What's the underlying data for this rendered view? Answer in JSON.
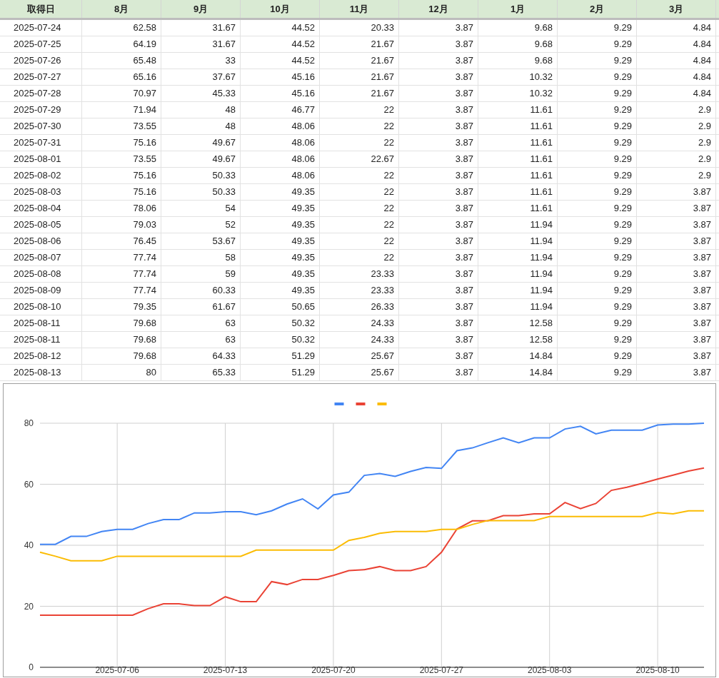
{
  "table": {
    "columns": [
      "取得日",
      "8月",
      "9月",
      "10月",
      "11月",
      "12月",
      "1月",
      "2月",
      "3月"
    ],
    "rows": [
      [
        "2025-07-24",
        "62.58",
        "31.67",
        "44.52",
        "20.33",
        "3.87",
        "9.68",
        "9.29",
        "4.84"
      ],
      [
        "2025-07-25",
        "64.19",
        "31.67",
        "44.52",
        "21.67",
        "3.87",
        "9.68",
        "9.29",
        "4.84"
      ],
      [
        "2025-07-26",
        "65.48",
        "33",
        "44.52",
        "21.67",
        "3.87",
        "9.68",
        "9.29",
        "4.84"
      ],
      [
        "2025-07-27",
        "65.16",
        "37.67",
        "45.16",
        "21.67",
        "3.87",
        "10.32",
        "9.29",
        "4.84"
      ],
      [
        "2025-07-28",
        "70.97",
        "45.33",
        "45.16",
        "21.67",
        "3.87",
        "10.32",
        "9.29",
        "4.84"
      ],
      [
        "2025-07-29",
        "71.94",
        "48",
        "46.77",
        "22",
        "3.87",
        "11.61",
        "9.29",
        "2.9"
      ],
      [
        "2025-07-30",
        "73.55",
        "48",
        "48.06",
        "22",
        "3.87",
        "11.61",
        "9.29",
        "2.9"
      ],
      [
        "2025-07-31",
        "75.16",
        "49.67",
        "48.06",
        "22",
        "3.87",
        "11.61",
        "9.29",
        "2.9"
      ],
      [
        "2025-08-01",
        "73.55",
        "49.67",
        "48.06",
        "22.67",
        "3.87",
        "11.61",
        "9.29",
        "2.9"
      ],
      [
        "2025-08-02",
        "75.16",
        "50.33",
        "48.06",
        "22",
        "3.87",
        "11.61",
        "9.29",
        "2.9"
      ],
      [
        "2025-08-03",
        "75.16",
        "50.33",
        "49.35",
        "22",
        "3.87",
        "11.61",
        "9.29",
        "3.87"
      ],
      [
        "2025-08-04",
        "78.06",
        "54",
        "49.35",
        "22",
        "3.87",
        "11.61",
        "9.29",
        "3.87"
      ],
      [
        "2025-08-05",
        "79.03",
        "52",
        "49.35",
        "22",
        "3.87",
        "11.94",
        "9.29",
        "3.87"
      ],
      [
        "2025-08-06",
        "76.45",
        "53.67",
        "49.35",
        "22",
        "3.87",
        "11.94",
        "9.29",
        "3.87"
      ],
      [
        "2025-08-07",
        "77.74",
        "58",
        "49.35",
        "22",
        "3.87",
        "11.94",
        "9.29",
        "3.87"
      ],
      [
        "2025-08-08",
        "77.74",
        "59",
        "49.35",
        "23.33",
        "3.87",
        "11.94",
        "9.29",
        "3.87"
      ],
      [
        "2025-08-09",
        "77.74",
        "60.33",
        "49.35",
        "23.33",
        "3.87",
        "11.94",
        "9.29",
        "3.87"
      ],
      [
        "2025-08-10",
        "79.35",
        "61.67",
        "50.65",
        "26.33",
        "3.87",
        "11.94",
        "9.29",
        "3.87"
      ],
      [
        "2025-08-11",
        "79.68",
        "63",
        "50.32",
        "24.33",
        "3.87",
        "12.58",
        "9.29",
        "3.87"
      ],
      [
        "2025-08-11",
        "79.68",
        "63",
        "50.32",
        "24.33",
        "3.87",
        "12.58",
        "9.29",
        "3.87"
      ],
      [
        "2025-08-12",
        "79.68",
        "64.33",
        "51.29",
        "25.67",
        "3.87",
        "14.84",
        "9.29",
        "3.87"
      ],
      [
        "2025-08-13",
        "80",
        "65.33",
        "51.29",
        "25.67",
        "3.87",
        "14.84",
        "9.29",
        "3.87"
      ]
    ]
  },
  "chart": {
    "chart_data": {
      "type": "line",
      "categories": [
        null,
        null,
        null,
        null,
        null,
        "2025-07-06",
        null,
        null,
        null,
        null,
        null,
        null,
        "2025-07-13",
        null,
        null,
        null,
        null,
        null,
        null,
        "2025-07-20",
        null,
        null,
        null,
        null,
        null,
        null,
        "2025-07-27",
        null,
        null,
        null,
        null,
        null,
        null,
        "2025-08-03",
        null,
        null,
        null,
        null,
        null,
        null,
        "2025-08-10",
        null,
        null,
        null
      ],
      "series": [
        {
          "color": "#4285f4",
          "values": [
            40.3,
            40.3,
            42.9,
            42.9,
            44.5,
            45.2,
            45.2,
            47.1,
            48.4,
            48.4,
            50.6,
            50.6,
            51,
            51,
            50,
            51.3,
            53.5,
            55.2,
            51.9,
            56.5,
            57.4,
            62.9,
            63.5,
            62.6,
            64.2,
            65.5,
            65.2,
            71,
            71.9,
            73.6,
            75.2,
            73.6,
            75.2,
            75.2,
            78.1,
            79,
            76.5,
            77.7,
            77.7,
            77.7,
            79.4,
            79.7,
            79.7,
            80
          ]
        },
        {
          "color": "#ea4335",
          "values": [
            17.1,
            17.1,
            17.1,
            17.1,
            17.1,
            17.1,
            17.1,
            19.2,
            20.8,
            20.8,
            20.2,
            20.2,
            23.1,
            21.5,
            21.5,
            28.1,
            27.1,
            28.8,
            28.8,
            30.1,
            31.7,
            32,
            33,
            31.7,
            31.7,
            33,
            37.7,
            45.3,
            48,
            48,
            49.7,
            49.7,
            50.3,
            50.3,
            54,
            52,
            53.7,
            58,
            59,
            60.3,
            61.7,
            63,
            64.3,
            65.3
          ]
        },
        {
          "color": "#fbbc04",
          "values": [
            37.7,
            36.4,
            34.9,
            34.9,
            34.9,
            36.4,
            36.4,
            36.4,
            36.4,
            36.4,
            36.4,
            36.4,
            36.4,
            36.4,
            38.4,
            38.4,
            38.4,
            38.4,
            38.4,
            38.4,
            41.6,
            42.6,
            43.9,
            44.5,
            44.5,
            44.5,
            45.2,
            45.2,
            46.8,
            48.1,
            48.1,
            48.1,
            48.1,
            49.4,
            49.4,
            49.4,
            49.4,
            49.4,
            49.4,
            49.4,
            50.7,
            50.3,
            51.3,
            51.3
          ]
        }
      ],
      "ylim": [
        0,
        80
      ],
      "yticks": [
        0,
        20,
        40,
        60,
        80
      ],
      "grid": true
    }
  }
}
